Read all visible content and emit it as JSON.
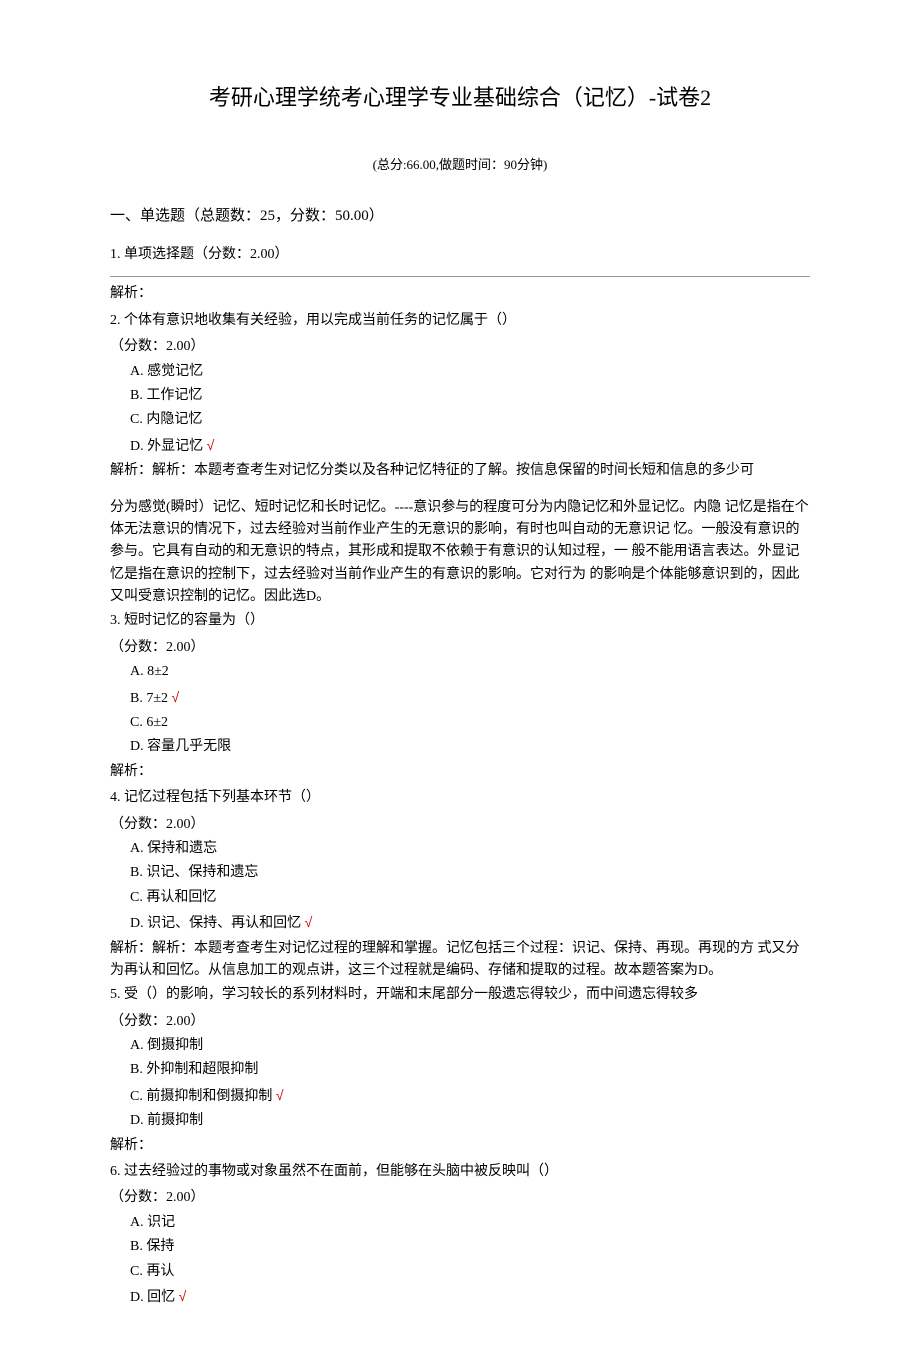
{
  "title": "考研心理学统考心理学专业基础综合（记忆）-试卷2",
  "meta": "(总分:66.00,做题时间：90分钟)",
  "section": "一、单选题（总题数：25，分数：50.00）",
  "q1": {
    "line": "1. 单项选择题（分数：2.00）",
    "analysis": "解析："
  },
  "q2": {
    "stem": "2. 个体有意识地收集有关经验，用以完成当前任务的记忆属于（）",
    "points": "（分数：2.00）",
    "optA": "A. 感觉记忆",
    "optB": "B. 工作记忆",
    "optC": "C. 内隐记忆",
    "optD": "D. 外显记忆 ",
    "check": "√",
    "ana1": "解析：解析：本题考查考生对记忆分类以及各种记忆特征的了解。按信息保留的时间长短和信息的多少可",
    "ana2": "分为感觉(瞬时）记忆、短时记忆和长时记忆。----意识参与的程度可分为内隐记忆和外显记忆。内隐 记忆是指在个体无法意识的情况下，过去经验对当前作业产生的无意识的影响，有时也叫自动的无意识记 忆。一般没有意识的参与。它具有自动的和无意识的特点，其形成和提取不依赖于有意识的认知过程，一 般不能用语言表达。外显记忆是指在意识的控制下，过去经验对当前作业产生的有意识的影响。它对行为 的影响是个体能够意识到的，因此又叫受意识控制的记忆。因此选D。"
  },
  "q3": {
    "stem": "3. 短时记忆的容量为（）",
    "points": "（分数：2.00）",
    "optA": "A. 8±2",
    "optB": "B. 7±2 ",
    "check": "√",
    "optC": "C. 6±2",
    "optD": "D. 容量几乎无限",
    "analysis": "解析："
  },
  "q4": {
    "stem": "4. 记忆过程包括下列基本环节（）",
    "points": "（分数：2.00）",
    "optA": "A. 保持和遗忘",
    "optB": "B. 识记、保持和遗忘",
    "optC": "C. 再认和回忆",
    "optD": "D. 识记、保持、再认和回忆 ",
    "check": "√",
    "analysis": "解析：解析：本题考查考生对记忆过程的理解和掌握。记忆包括三个过程：识记、保持、再现。再现的方 式又分为再认和回忆。从信息加工的观点讲，这三个过程就是编码、存储和提取的过程。故本题答案为D。"
  },
  "q5": {
    "stem": "5. 受（）的影响，学习较长的系列材料时，开端和末尾部分一般遗忘得较少，而中间遗忘得较多",
    "points": "（分数：2.00）",
    "optA": "A. 倒摄抑制",
    "optB": "B. 外抑制和超限抑制",
    "optC": "C. 前摄抑制和倒摄抑制 ",
    "check": "√",
    "optD": "D. 前摄抑制",
    "analysis": "解析："
  },
  "q6": {
    "stem": "6. 过去经验过的事物或对象虽然不在面前，但能够在头脑中被反映叫（）",
    "points": "（分数：2.00）",
    "optA": "A. 识记",
    "optB": "B. 保持",
    "optC": "C. 再认",
    "optD": "D. 回忆 ",
    "check": "√"
  }
}
